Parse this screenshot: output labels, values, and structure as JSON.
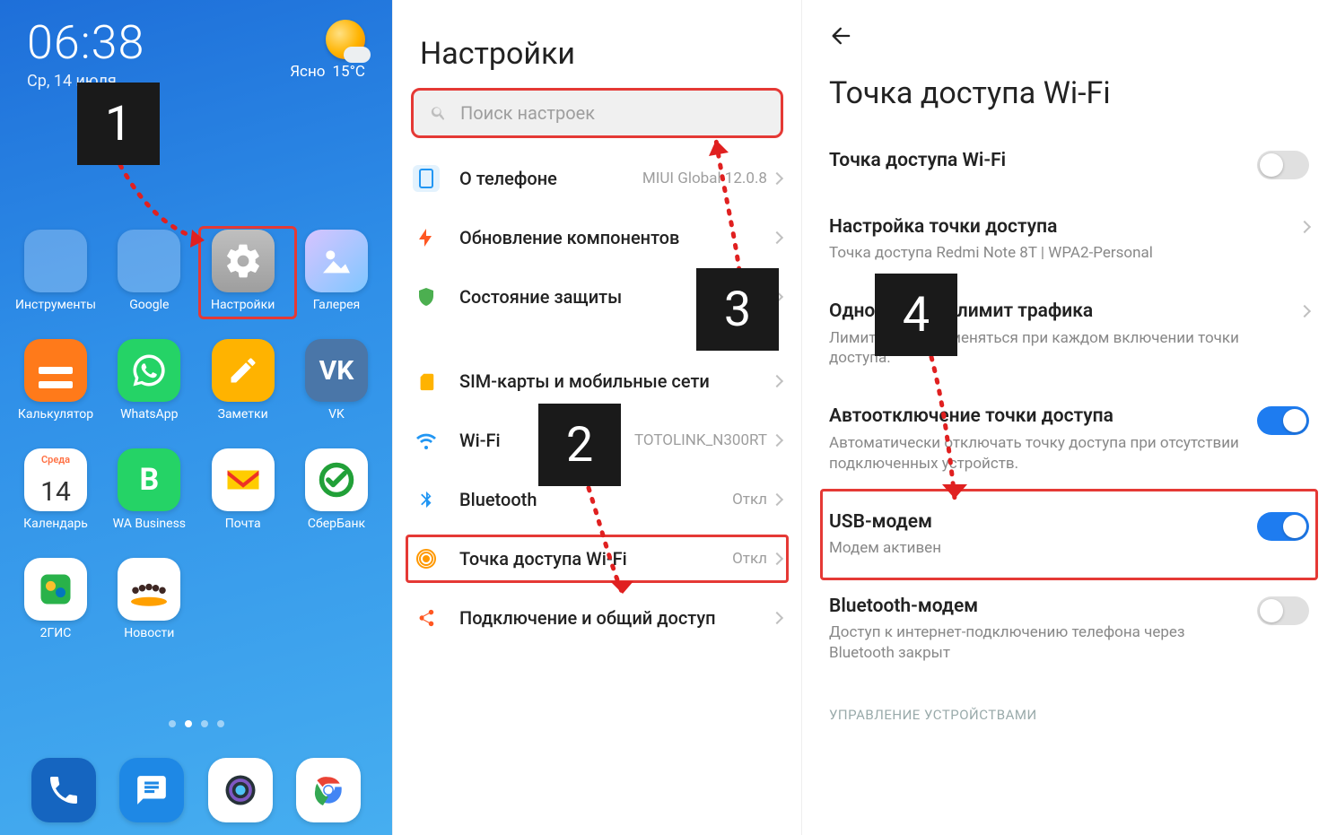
{
  "home": {
    "time": "06:38",
    "date": "Ср, 14 июля",
    "weather_label": "Ясно",
    "weather_temp": "15°C",
    "calendar_day_label": "Среда",
    "calendar_day_num": "14",
    "apps": {
      "tools": "Инструменты",
      "google": "Google",
      "settings": "Настройки",
      "gallery": "Галерея",
      "calculator": "Калькулятор",
      "whatsapp": "WhatsApp",
      "notes": "Заметки",
      "vk": "VK",
      "calendar": "Календарь",
      "wabusiness": "WA Business",
      "mail": "Почта",
      "sberbank": "СберБанк",
      "dgis": "2ГИС",
      "news": "Новости"
    }
  },
  "settings": {
    "title": "Настройки",
    "search_placeholder": "Поиск настроек",
    "items": {
      "about": {
        "label": "О телефоне",
        "value": "MIUI Global 12.0.8"
      },
      "update": {
        "label": "Обновление компонентов"
      },
      "security": {
        "label": "Состояние защиты"
      },
      "sim": {
        "label": "SIM-карты и мобильные сети"
      },
      "wifi": {
        "label": "Wi-Fi",
        "value": "TOTOLINK_N300RT"
      },
      "bluetooth": {
        "label": "Bluetooth",
        "value": "Откл"
      },
      "hotspot": {
        "label": "Точка доступа Wi-Fi",
        "value": "Откл"
      },
      "share": {
        "label": "Подключение и общий доступ"
      }
    }
  },
  "hotspot": {
    "title": "Точка доступа Wi-Fi",
    "rows": {
      "enable": {
        "title": "Точка доступа Wi-Fi"
      },
      "setup": {
        "title": "Настройка точки доступа",
        "sub": "Точка доступа Redmi Note 8T | WPA2-Personal"
      },
      "limit": {
        "title": "Однократный лимит трафика",
        "sub": "Лимит будет применяться при каждом включении точки доступа."
      },
      "autooff": {
        "title": "Автоотключение точки доступа",
        "sub": "Автоматически отключать точку доступа при отсутствии подключенных устройств."
      },
      "usb": {
        "title": "USB-модем",
        "sub": "Модем активен"
      },
      "bt": {
        "title": "Bluetooth-модем",
        "sub": "Доступ к интернет-подключению телефона через Bluetooth закрыт"
      }
    },
    "section": "УПРАВЛЕНИЕ УСТРОЙСТВАМИ"
  },
  "steps": {
    "s1": "1",
    "s2": "2",
    "s3": "3",
    "s4": "4"
  }
}
